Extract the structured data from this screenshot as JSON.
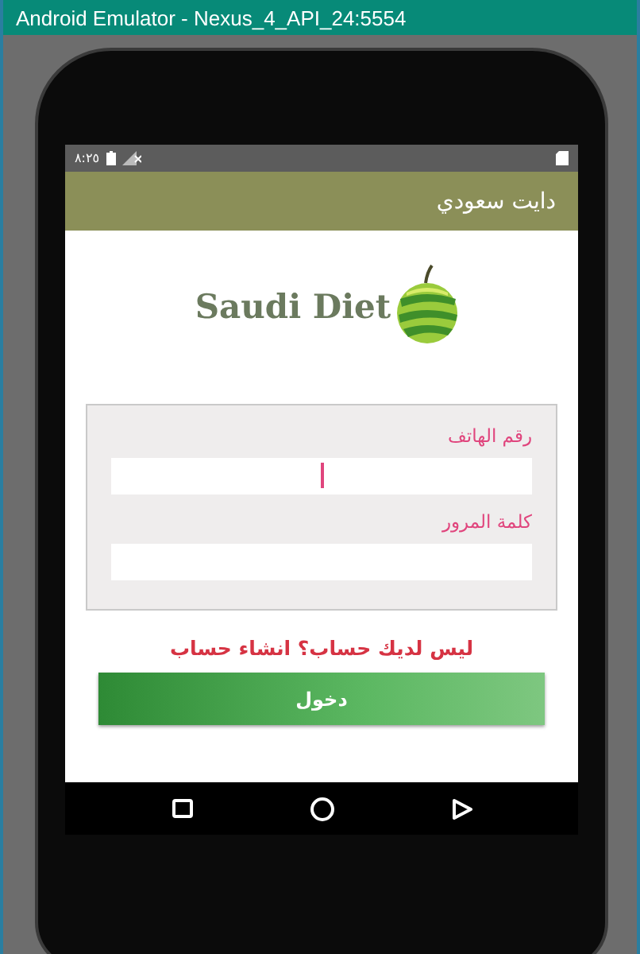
{
  "window": {
    "title": "Android Emulator - Nexus_4_API_24:5554"
  },
  "status_bar": {
    "time": "٨:٢٥"
  },
  "app_bar": {
    "title": "دايت سعودي"
  },
  "logo": {
    "text": "Saudi Diet"
  },
  "form": {
    "fields": [
      {
        "label": "رقم الهاتف",
        "focused": true
      },
      {
        "label": "كلمة المرور",
        "focused": false
      }
    ]
  },
  "signup_link": "ليس لديك حساب؟ انشاء حساب",
  "login_button": "دخول"
}
